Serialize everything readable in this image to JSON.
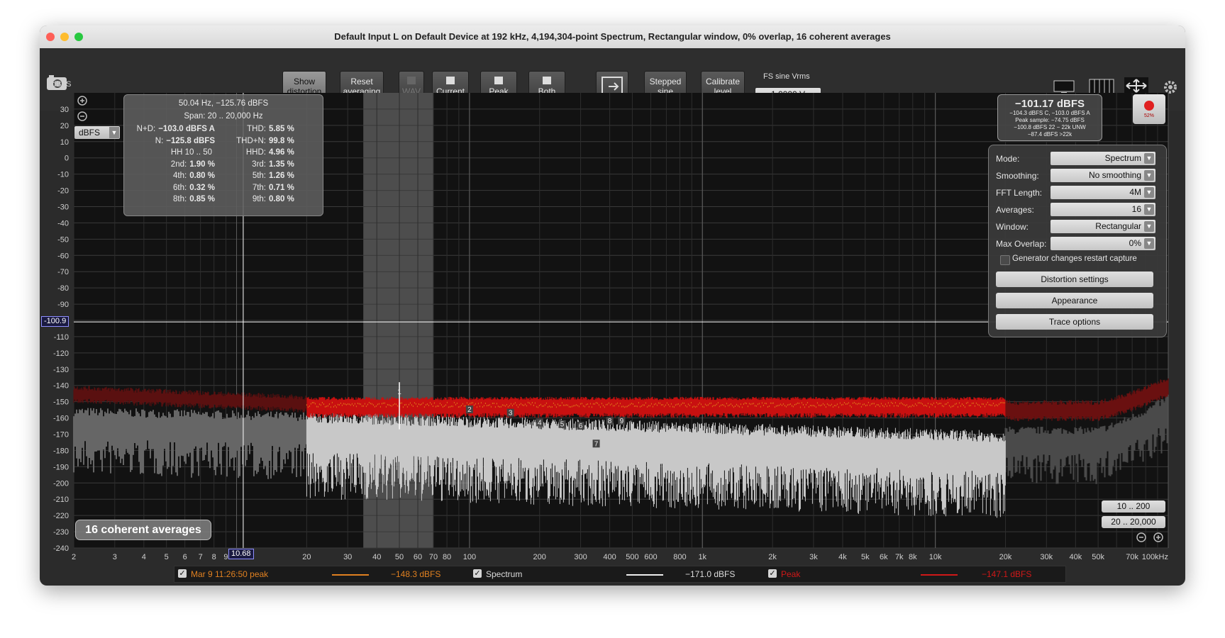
{
  "window": {
    "title": "Default Input L on Default Device at 192 kHz, 4,194,304-point Spectrum, Rectangular window, 0% overlap, 16 coherent averages"
  },
  "toolbar": {
    "show_distortion": [
      "Show",
      "distortion"
    ],
    "reset_averaging": [
      "Reset",
      "averaging"
    ],
    "wav": "WAV",
    "current": "Current",
    "peak": "Peak",
    "both": "Both",
    "stepped_sine": [
      "Stepped",
      "sine"
    ],
    "calibrate_level": [
      "Calibrate",
      "level"
    ],
    "fs_sine_label": "FS sine Vrms",
    "fs_sine_value": "1.0000 V"
  },
  "y_axis": {
    "unit_label": "dBFS",
    "unit_select": "dBFS",
    "ticks": [
      "30",
      "20",
      "10",
      "0",
      "-10",
      "-20",
      "-30",
      "-40",
      "-50",
      "-60",
      "-70",
      "-80",
      "-90",
      "-110",
      "-120",
      "-130",
      "-140",
      "-150",
      "-160",
      "-170",
      "-180",
      "-190",
      "-200",
      "-210",
      "-220",
      "-230",
      "-240"
    ],
    "cursor_readout": "-100.9"
  },
  "x_axis": {
    "ticks": [
      "2",
      "3",
      "4",
      "5",
      "6",
      "7",
      "8",
      "9",
      "20",
      "30",
      "40",
      "50",
      "60",
      "70",
      "80",
      "100",
      "200",
      "300",
      "400",
      "500",
      "600",
      "800",
      "1k",
      "2k",
      "3k",
      "4k",
      "5k",
      "6k",
      "7k",
      "8k",
      "10k",
      "20k",
      "30k",
      "40k",
      "50k",
      "70k",
      "100kHz"
    ],
    "cursor_readout": "10.68"
  },
  "info": {
    "header": "50.04 Hz, −125.76 dBFS",
    "span": "Span: 20 .. 20,000 Hz",
    "rows": [
      {
        "left_label": "N+D:",
        "left_value": "−103.0 dBFS A",
        "right_label": "THD:",
        "right_value": "5.85 %"
      },
      {
        "left_label": "N:",
        "left_value": "−125.8 dBFS",
        "right_label": "THD+N:",
        "right_value": "99.8 %"
      },
      {
        "left_label": "HH 10 .. 50",
        "left_value": "",
        "right_label": "HHD:",
        "right_value": "4.96 %"
      },
      {
        "left_label": "2nd:",
        "left_value": "1.90 %",
        "right_label": "3rd:",
        "right_value": "1.35 %"
      },
      {
        "left_label": "4th:",
        "left_value": "0.80 %",
        "right_label": "5th:",
        "right_value": "1.26 %"
      },
      {
        "left_label": "6th:",
        "left_value": "0.32 %",
        "right_label": "7th:",
        "right_value": "0.71 %"
      },
      {
        "left_label": "8th:",
        "left_value": "0.85 %",
        "right_label": "9th:",
        "right_value": "0.80 %"
      }
    ]
  },
  "level": {
    "main": "−101.17 dBFS",
    "lines": [
      "−104.3 dBFS C, −103.0 dBFS A",
      "Peak sample: −74.75 dBFS",
      "−100.8 dBFS 22 − 22k UNW",
      "−87.4 dBFS >22k"
    ],
    "rec_pct": "52%"
  },
  "settings": {
    "rows": [
      {
        "label": "Mode:",
        "value": "Spectrum"
      },
      {
        "label": "Smoothing:",
        "value": "No  smoothing"
      },
      {
        "label": "FFT Length:",
        "value": "4M"
      },
      {
        "label": "Averages:",
        "value": "16"
      },
      {
        "label": "Window:",
        "value": "Rectangular"
      },
      {
        "label": "Max Overlap:",
        "value": "0%"
      }
    ],
    "generator_checkbox": "Generator changes restart capture",
    "distortion_settings": "Distortion settings",
    "appearance": "Appearance",
    "trace_options": "Trace options"
  },
  "ranges": {
    "r1": "10 .. 200",
    "r2": "20 .. 20,000"
  },
  "averages_badge": "16 coherent averages",
  "legend": {
    "items": [
      {
        "label": "Mar 9 11:26:50 peak",
        "value": "−148.3 dBFS",
        "color": "#e08020"
      },
      {
        "label": "Spectrum",
        "value": "−171.0 dBFS",
        "color": "#ffffff"
      },
      {
        "label": "Peak",
        "value": "−147.1 dBFS",
        "color": "#d01818"
      }
    ]
  },
  "harmonic_markers": [
    "1",
    "2",
    "3",
    "4",
    "5",
    "6",
    "7",
    "8",
    "9"
  ],
  "colors": {
    "spectrum": "#c8c8c8",
    "peak": "#cc1010",
    "snapshot_peak": "#e08020",
    "band_highlight": "#5a5a5a"
  }
}
